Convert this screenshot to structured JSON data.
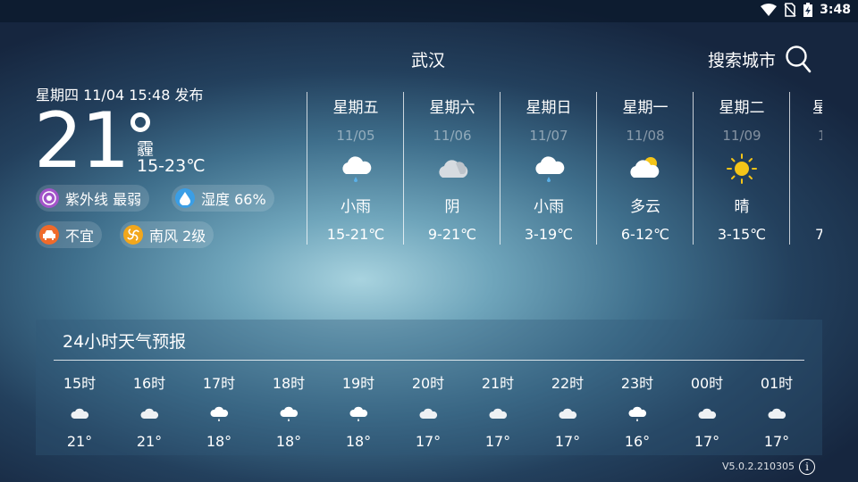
{
  "status_bar": {
    "time": "3:48",
    "icons": [
      "wifi-icon",
      "no-sim-icon",
      "battery-charging-icon"
    ]
  },
  "header": {
    "city": "武汉",
    "search_label": "搜索城市"
  },
  "current": {
    "publish": "星期四  11/04  15:48 发布",
    "temp": "21",
    "condition": "霾",
    "range": "15-23℃",
    "uv": "紫外线 最弱",
    "humidity": "湿度 66%",
    "car_wash": "不宜",
    "wind": "南风 2级",
    "colors": {
      "uv": "#a254c9",
      "humidity": "#3a9ee6",
      "car": "#f06a2a",
      "wind": "#f2a71c"
    }
  },
  "forecast": [
    {
      "day": "星期五",
      "date": "11/05",
      "icon": "light-rain-icon",
      "cond": "小雨",
      "range": "15-21℃"
    },
    {
      "day": "星期六",
      "date": "11/06",
      "icon": "overcast-icon",
      "cond": "阴",
      "range": "9-21℃"
    },
    {
      "day": "星期日",
      "date": "11/07",
      "icon": "light-rain-icon",
      "cond": "小雨",
      "range": "3-19℃"
    },
    {
      "day": "星期一",
      "date": "11/08",
      "icon": "partly-cloudy-icon",
      "cond": "多云",
      "range": "6-12℃"
    },
    {
      "day": "星期二",
      "date": "11/09",
      "icon": "sunny-icon",
      "cond": "晴",
      "range": "3-15℃"
    },
    {
      "day": "星",
      "date": "1",
      "icon": "",
      "cond": "",
      "range": "7"
    }
  ],
  "hourly": {
    "title": "24小时天气预报",
    "items": [
      {
        "time": "15时",
        "icon": "cloud-icon",
        "temp": "21°"
      },
      {
        "time": "16时",
        "icon": "cloud-icon",
        "temp": "21°"
      },
      {
        "time": "17时",
        "icon": "rain-icon",
        "temp": "18°"
      },
      {
        "time": "18时",
        "icon": "rain-icon",
        "temp": "18°"
      },
      {
        "time": "19时",
        "icon": "rain-icon",
        "temp": "18°"
      },
      {
        "time": "20时",
        "icon": "cloud-icon",
        "temp": "17°"
      },
      {
        "time": "21时",
        "icon": "cloud-icon",
        "temp": "17°"
      },
      {
        "time": "22时",
        "icon": "cloud-icon",
        "temp": "17°"
      },
      {
        "time": "23时",
        "icon": "rain-icon",
        "temp": "16°"
      },
      {
        "time": "00时",
        "icon": "cloud-icon",
        "temp": "17°"
      },
      {
        "time": "01时",
        "icon": "cloud-icon",
        "temp": "17°"
      }
    ]
  },
  "footer": {
    "version": "V5.0.2.210305"
  }
}
